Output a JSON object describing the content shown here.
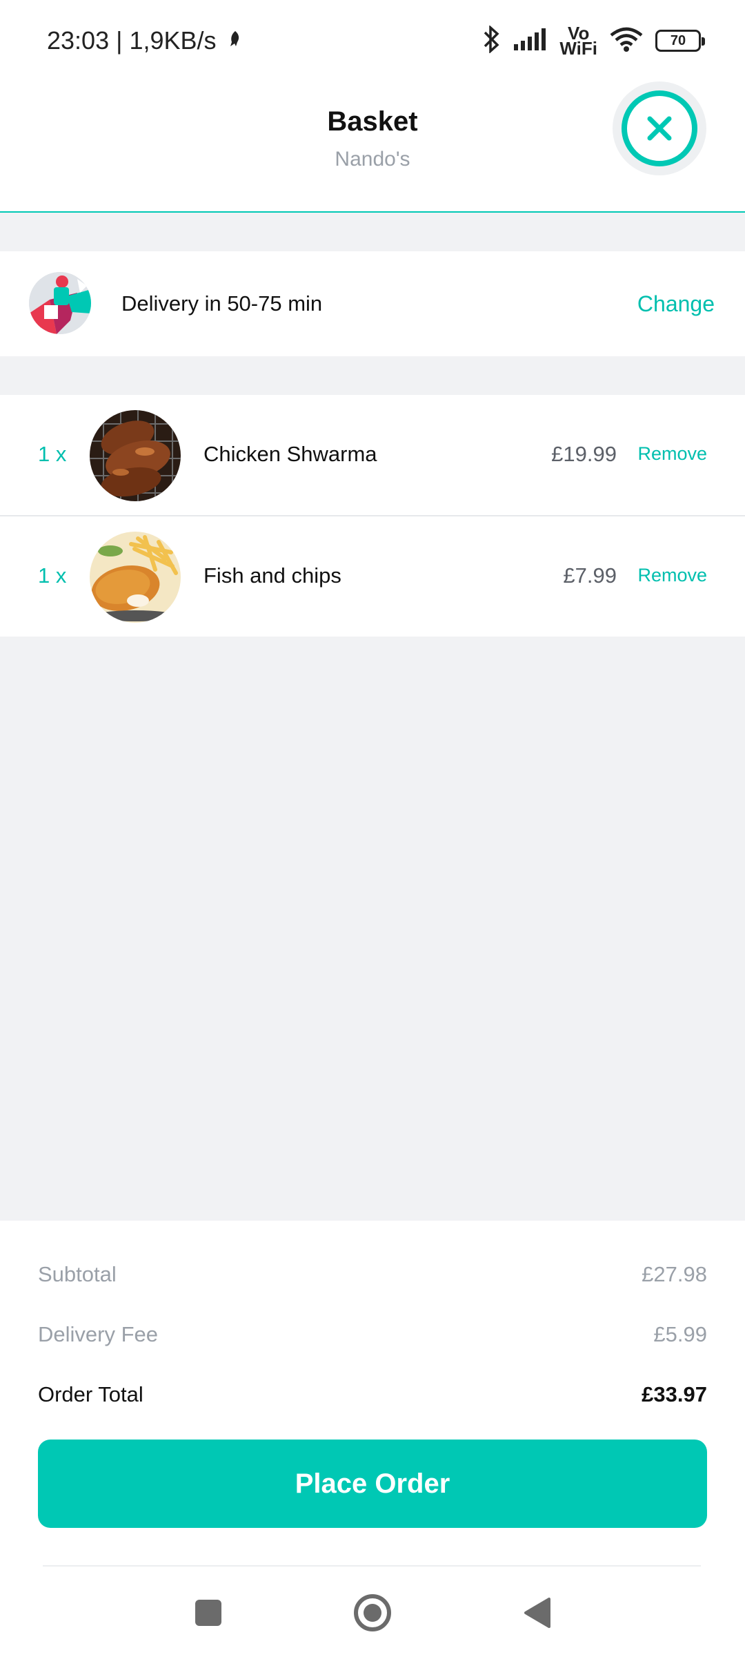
{
  "status_bar": {
    "time_speed": "23:03 | 1,9KB/s",
    "network_label": "Vo\nWiFi",
    "battery": "70"
  },
  "header": {
    "title": "Basket",
    "subtitle": "Nando's"
  },
  "delivery": {
    "text": "Delivery in 50-75 min",
    "change_label": "Change"
  },
  "items": [
    {
      "qty": "1 x",
      "name": "Chicken Shwarma",
      "price": "£19.99",
      "remove_label": "Remove"
    },
    {
      "qty": "1 x",
      "name": "Fish and chips",
      "price": "£7.99",
      "remove_label": "Remove"
    }
  ],
  "summary": {
    "subtotal_label": "Subtotal",
    "subtotal_value": "£27.98",
    "delivery_fee_label": "Delivery Fee",
    "delivery_fee_value": "£5.99",
    "total_label": "Order Total",
    "total_value": "£33.97"
  },
  "place_order_label": "Place Order",
  "colors": {
    "accent": "#00c8b4",
    "background": "#f1f2f4",
    "muted_text": "#9aa0a8"
  }
}
